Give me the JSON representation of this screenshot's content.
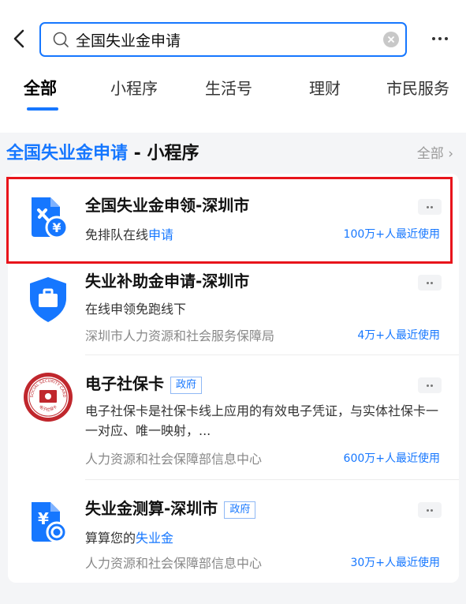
{
  "search": {
    "value": "全国失业金申请"
  },
  "tabs": [
    "全部",
    "小程序",
    "生活号",
    "理财",
    "市民服务"
  ],
  "section": {
    "title_main": "全国失业金申请",
    "title_suffix": " - 小程序",
    "all_link": "全部 ›"
  },
  "results": [
    {
      "title": "全国失业金申领-深圳市",
      "desc_prefix": "免排队在线",
      "desc_highlight": "申请",
      "usage": "100万+人最近使用",
      "icon": "document-yuan-icon"
    },
    {
      "title": "失业补助金申请-深圳市",
      "desc": "在线申领免跑线下",
      "org": "深圳市人力资源和社会服务保障局",
      "usage": "4万+人最近使用",
      "icon": "shield-briefcase-icon"
    },
    {
      "title": "电子社保卡",
      "badge": "政府",
      "desc": "电子社保卡是社保卡线上应用的有效电子凭证，与实体社保卡一一对应、唯一映射，...",
      "org": "人力资源和社会保障部信息中心",
      "usage": "600万+人最近使用",
      "icon": "social-security-seal-icon",
      "seal_top": "SOCIAL SECURITY CARD",
      "seal_bottom": "电子社保卡"
    },
    {
      "title": "失业金测算-深圳市",
      "badge": "政府",
      "desc_prefix": "算算您的",
      "desc_highlight": "失业金",
      "org": "人力资源和社会保障部信息中心",
      "usage": "30万+人最近使用",
      "icon": "calculator-yuan-icon"
    }
  ],
  "colors": {
    "accent": "#1677ff",
    "highlight_box": "#e8141b",
    "seal": "#c0272d"
  }
}
